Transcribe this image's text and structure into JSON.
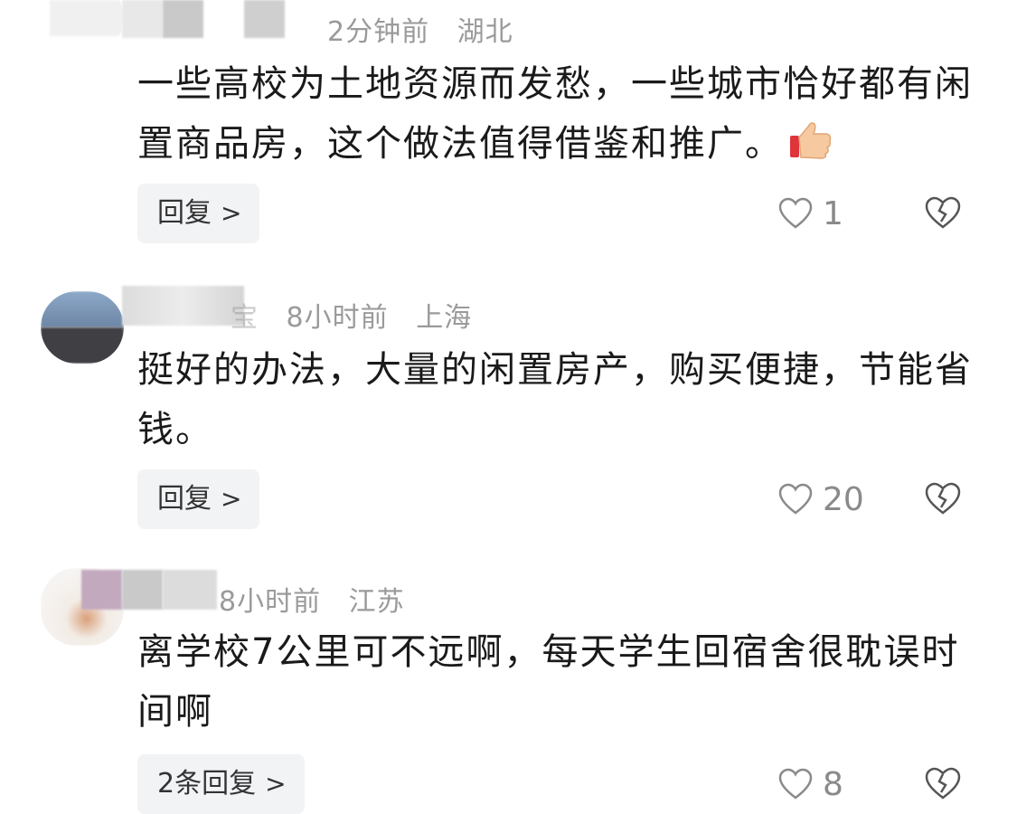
{
  "comments": [
    {
      "time": "2分钟前",
      "location": "湖北",
      "text": "一些高校为土地资源而发愁，一些城市恰好都有闲置商品房，这个做法值得借鉴和推广。",
      "reply_label": "回复",
      "likes": "1",
      "emoji": "thumbs-up-icon"
    },
    {
      "name_partial": "宝",
      "time": "8小时前",
      "location": "上海",
      "text": "挺好的办法，大量的闲置房产，购买便捷，节能省钱。",
      "reply_label": "回复",
      "likes": "20"
    },
    {
      "time": "8小时前",
      "location": "江苏",
      "text": "离学校7公里可不远啊，每天学生回宿舍很耽误时间啊",
      "reply_label": "2条回复",
      "likes": "8"
    }
  ],
  "colors": {
    "meta_text": "#9a9a9a",
    "body_text": "#1a1a1a",
    "reply_bg": "#f2f3f5",
    "icon_stroke": "#8a8a8a"
  }
}
